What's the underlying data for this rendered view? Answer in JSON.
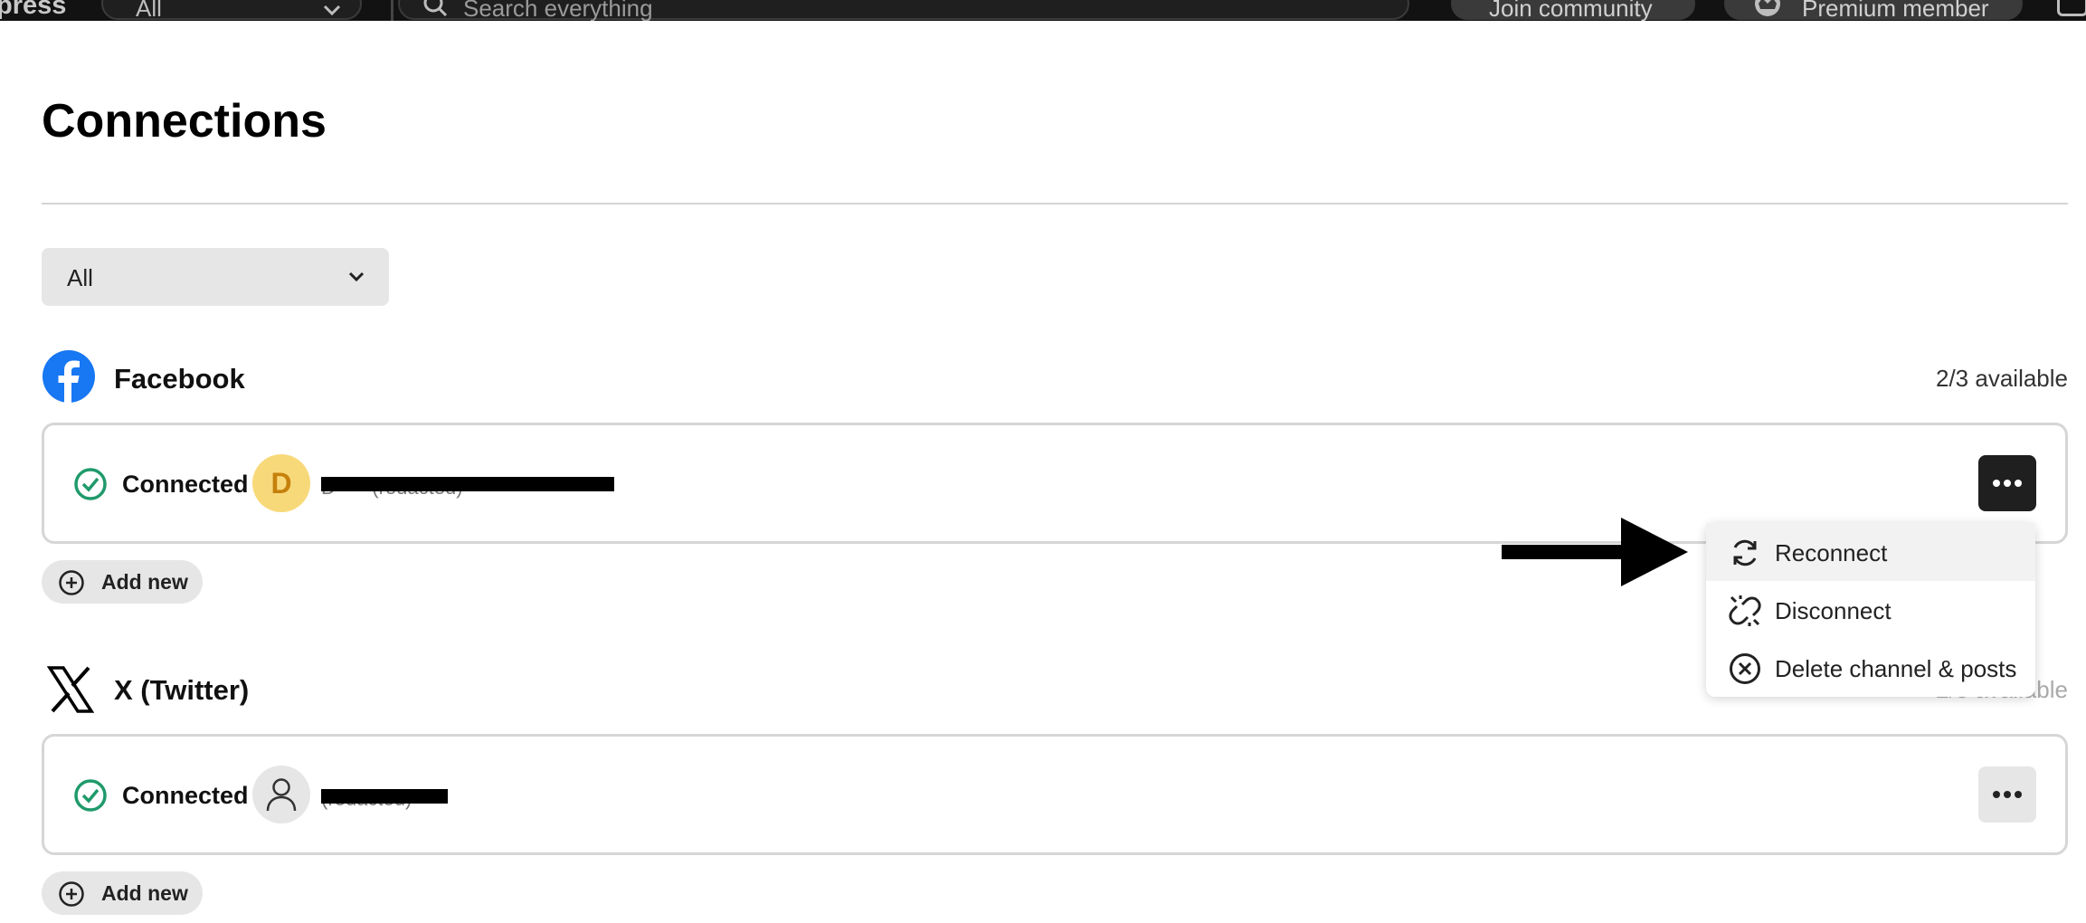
{
  "topbar": {
    "brand": "press",
    "filter_value": "All",
    "search_placeholder": "Search everything",
    "join_label": "Join community",
    "premium_label": "Premium member"
  },
  "page": {
    "title": "Connections"
  },
  "filter": {
    "value": "All"
  },
  "sections": [
    {
      "platform": "Facebook",
      "available": "2/3 available",
      "connection": {
        "status": "Connected",
        "avatar_letter": "D",
        "account_name": "D**** (redacted)"
      },
      "add_new": "Add new"
    },
    {
      "platform": "X (Twitter)",
      "available": "2/3 available",
      "connection": {
        "status": "Connected",
        "account_name": "(redacted)"
      },
      "add_new": "Add new"
    }
  ],
  "context_menu": {
    "items": [
      {
        "label": "Reconnect",
        "icon": "refresh-icon"
      },
      {
        "label": "Disconnect",
        "icon": "broken-link-icon"
      },
      {
        "label": "Delete channel & posts",
        "icon": "circle-x-icon"
      }
    ]
  },
  "colors": {
    "topbar_bg": "#121212",
    "facebook_blue": "#1877f2",
    "connected_green": "#1f9a6b",
    "avatar_yellow": "#f8d97a"
  }
}
